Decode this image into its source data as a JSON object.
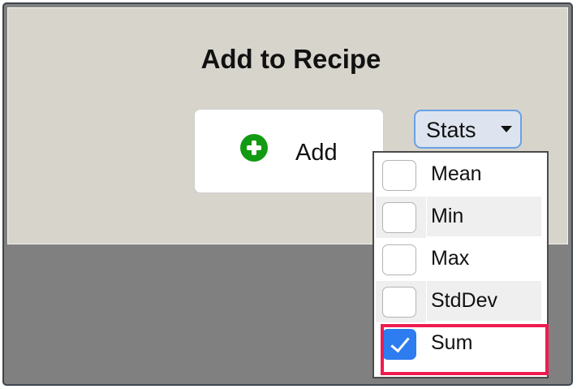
{
  "dialog": {
    "title": "Add to Recipe"
  },
  "add_button": {
    "label": "Add",
    "icon": "plus-circle-icon",
    "icon_color": "#139a13"
  },
  "stats_dropdown": {
    "label": "Stats",
    "accent": "#6aa1e5",
    "options": [
      {
        "label": "Mean",
        "checked": false
      },
      {
        "label": "Min",
        "checked": false
      },
      {
        "label": "Max",
        "checked": false
      },
      {
        "label": "StdDev",
        "checked": false
      },
      {
        "label": "Sum",
        "checked": true
      }
    ]
  },
  "highlight_color": "#ee1c4e",
  "checkbox_color": "#2d7cf0"
}
